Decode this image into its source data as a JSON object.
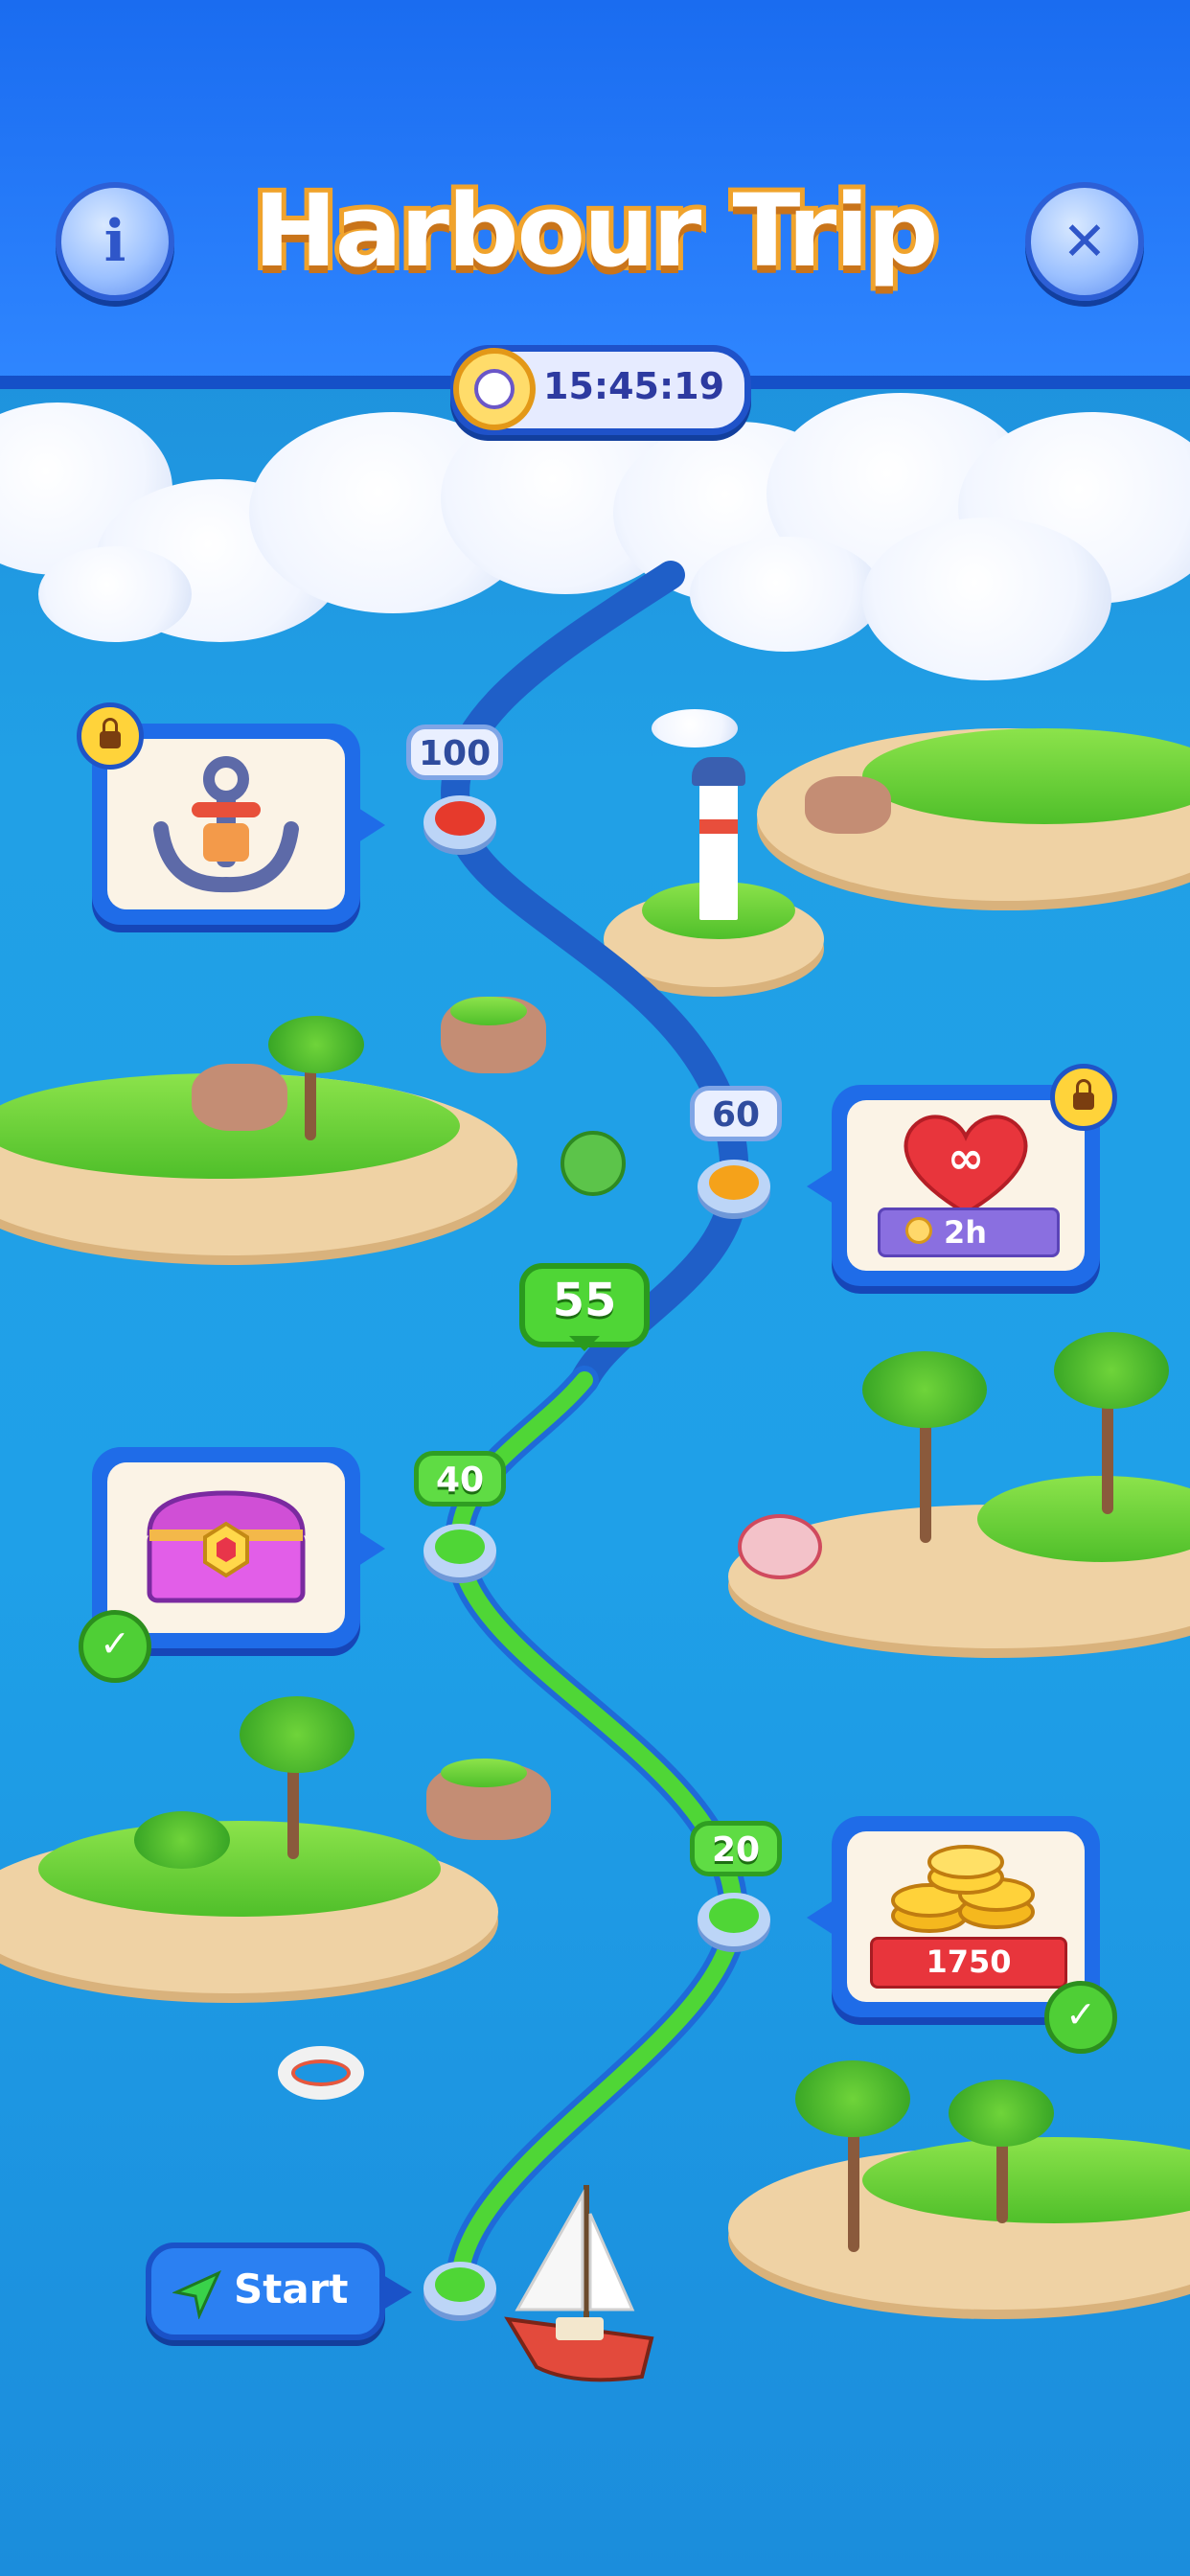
{
  "header": {
    "title": "Harbour Trip",
    "info_label": "i",
    "close_label": "✕",
    "timer": "15:45:19"
  },
  "path": {
    "levels": [
      {
        "label": "100",
        "state": "locked"
      },
      {
        "label": "60",
        "state": "locked"
      },
      {
        "label": "55",
        "state": "current"
      },
      {
        "label": "40",
        "state": "done"
      },
      {
        "label": "20",
        "state": "done"
      }
    ],
    "start_label": "Start"
  },
  "rewards": [
    {
      "level": "100",
      "item": "anchor",
      "status": "locked"
    },
    {
      "level": "60",
      "item": "infinite-heart",
      "amount": "2h",
      "status": "locked"
    },
    {
      "level": "40",
      "item": "treasure-chest",
      "status": "claimed"
    },
    {
      "level": "20",
      "item": "gold-coins",
      "amount": "1750",
      "status": "claimed"
    }
  ],
  "colors": {
    "header_blue": "#1a6cf0",
    "sea_blue": "#21a0e6",
    "path_done": "#4fd636",
    "path_locked": "#1f5fc8",
    "node_red": "#e63a2c",
    "node_orange": "#f5a21a",
    "title_outline": "#f0a32c"
  }
}
